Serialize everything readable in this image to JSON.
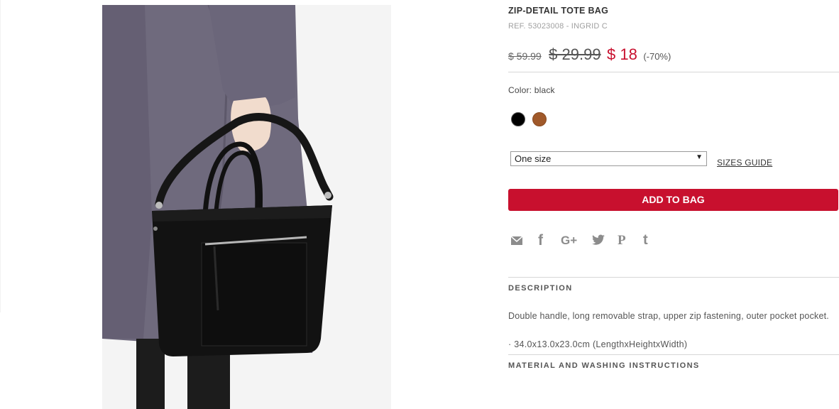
{
  "product": {
    "title": "ZIP-DETAIL TOTE BAG",
    "reference": "REF. 53023008 - INGRID C",
    "photo_alt": "model holding black tote bag"
  },
  "pricing": {
    "original": "$ 59.99",
    "previous": "$ 29.99",
    "current": "$ 18",
    "discount": "(-70%)",
    "sale_color": "#c8102e"
  },
  "color": {
    "label": "Color: black",
    "swatches": [
      {
        "name": "black",
        "hex": "#000000",
        "selected": true
      },
      {
        "name": "brown",
        "hex": "#a0592a",
        "selected": false
      }
    ]
  },
  "size": {
    "selected": "One size",
    "guide_label": "SIZES GUIDE"
  },
  "actions": {
    "add_to_bag": "ADD TO BAG",
    "button_color": "#c8102e"
  },
  "share": {
    "icons": [
      "email-icon",
      "facebook-icon",
      "google-plus-icon",
      "twitter-icon",
      "pinterest-icon",
      "tumblr-icon"
    ],
    "glyphs": {
      "facebook": "f",
      "google_plus": "G+",
      "pinterest": "P",
      "tumblr": "t"
    }
  },
  "description": {
    "heading": "DESCRIPTION",
    "text": "Double handle, long removable strap, upper zip fastening, outer pocket pocket.",
    "dimensions": "· 34.0x13.0x23.0cm (LengthxHeightxWidth)"
  },
  "material": {
    "heading": "MATERIAL AND WASHING INSTRUCTIONS"
  }
}
